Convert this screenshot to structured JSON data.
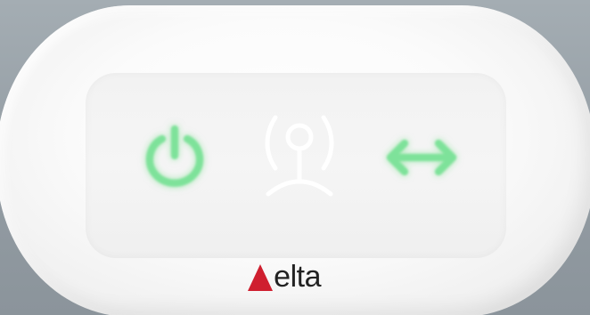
{
  "brand": {
    "name": "Delta",
    "display_text": " elta",
    "triangle_color": "#cf1f2f",
    "text_color": "#222222"
  },
  "indicators": [
    {
      "id": "power",
      "icon": "power-icon",
      "color": "#7ee29a"
    },
    {
      "id": "signal",
      "icon": "signal-icon",
      "color": "#ffffff"
    },
    {
      "id": "arrows",
      "icon": "double-arrow-icon",
      "color": "#7ee29a"
    }
  ]
}
